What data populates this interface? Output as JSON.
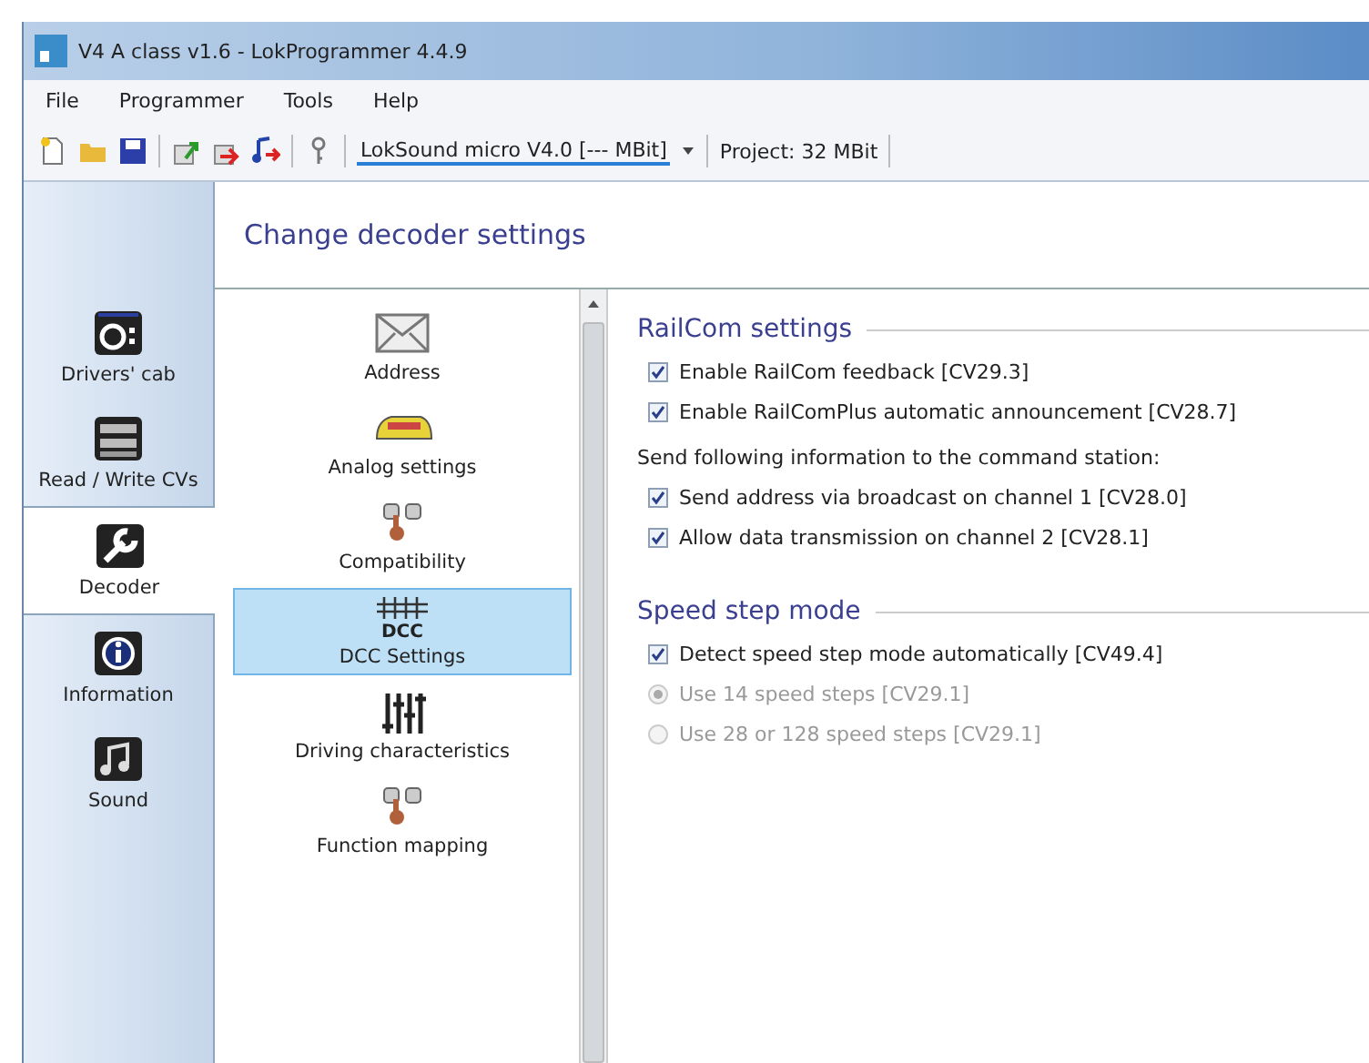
{
  "window": {
    "title": "V4 A class v1.6 - LokProgrammer 4.4.9"
  },
  "menu": [
    "File",
    "Programmer",
    "Tools",
    "Help"
  ],
  "toolbar": {
    "device": "LokSound micro V4.0 [--- MBit]",
    "project": "Project:  32 MBit"
  },
  "nav": [
    {
      "label": "Drivers' cab",
      "kind": "cab",
      "selected": false
    },
    {
      "label": "Read / Write CVs",
      "kind": "cvs",
      "selected": false
    },
    {
      "label": "Decoder",
      "kind": "wrench",
      "selected": true
    },
    {
      "label": "Information",
      "kind": "info",
      "selected": false
    },
    {
      "label": "Sound",
      "kind": "sound",
      "selected": false
    }
  ],
  "header": "Change decoder settings",
  "categories": [
    {
      "label": "Address",
      "kind": "envelope",
      "selected": false
    },
    {
      "label": "Analog settings",
      "kind": "train",
      "selected": false
    },
    {
      "label": "Compatibility",
      "kind": "hand",
      "selected": false
    },
    {
      "label": "DCC Settings",
      "kind": "dcc",
      "icon_text": "DCC",
      "selected": true
    },
    {
      "label": "Driving characteristics",
      "kind": "sliders",
      "selected": false
    },
    {
      "label": "Function mapping",
      "kind": "hand",
      "selected": false
    }
  ],
  "sections": [
    {
      "title": "RailCom settings",
      "items": [
        {
          "kind": "checkbox",
          "label": "Enable RailCom feedback [CV29.3]",
          "checked": true,
          "disabled": false
        },
        {
          "kind": "checkbox",
          "label": "Enable RailComPlus automatic announcement [CV28.7]",
          "checked": true,
          "disabled": false
        },
        {
          "kind": "note",
          "label": "Send following information to the command station:"
        },
        {
          "kind": "checkbox",
          "label": "Send address via broadcast on channel 1 [CV28.0]",
          "checked": true,
          "disabled": false
        },
        {
          "kind": "checkbox",
          "label": "Allow data transmission on channel 2 [CV28.1]",
          "checked": true,
          "disabled": false
        }
      ]
    },
    {
      "title": "Speed step mode",
      "items": [
        {
          "kind": "checkbox",
          "label": "Detect speed step mode automatically [CV49.4]",
          "checked": true,
          "disabled": false
        },
        {
          "kind": "radio",
          "label": "Use 14 speed steps [CV29.1]",
          "selected": true,
          "disabled": true
        },
        {
          "kind": "radio",
          "label": "Use 28 or 128 speed steps [CV29.1]",
          "selected": false,
          "disabled": true
        }
      ]
    }
  ]
}
